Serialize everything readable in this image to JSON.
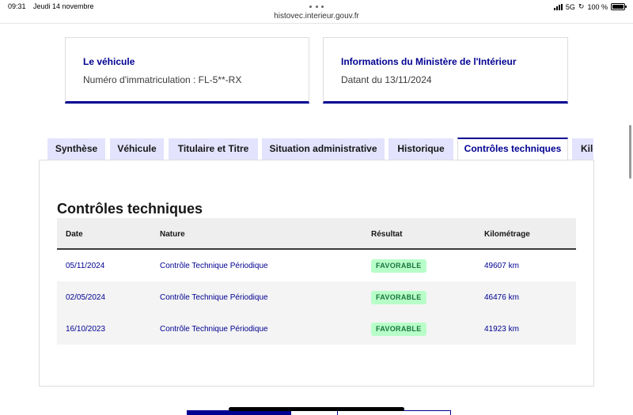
{
  "status_bar": {
    "time": "09:31",
    "date": "Jeudi 14 novembre",
    "url": "histovec.interieur.gouv.fr",
    "network": "5G",
    "battery_text": "100 %",
    "battery_level": 1.0
  },
  "vehicle_card": {
    "title": "Le véhicule",
    "text": "Numéro d'immatriculation : FL-5**-RX"
  },
  "ministry_card": {
    "title": "Informations du Ministère de l'Intérieur",
    "text": "Datant du 13/11/2024"
  },
  "tabs": [
    {
      "label": "Synthèse",
      "active": false
    },
    {
      "label": "Véhicule",
      "active": false
    },
    {
      "label": "Titulaire et Titre",
      "active": false
    },
    {
      "label": "Situation administrative",
      "active": false
    },
    {
      "label": "Historique",
      "active": false
    },
    {
      "label": "Contrôles techniques",
      "active": true
    },
    {
      "label": "Kilo",
      "active": false
    }
  ],
  "section": {
    "title": "Contrôles techniques"
  },
  "table": {
    "headers": {
      "date": "Date",
      "nature": "Nature",
      "result": "Résultat",
      "mileage": "Kilométrage"
    },
    "rows": [
      {
        "date": "05/11/2024",
        "nature": "Contrôle Technique Périodique",
        "result": "FAVORABLE",
        "mileage": "49607 km"
      },
      {
        "date": "02/05/2024",
        "nature": "Contrôle Technique Périodique",
        "result": "FAVORABLE",
        "mileage": "46476 km"
      },
      {
        "date": "16/10/2023",
        "nature": "Contrôle Technique Périodique",
        "result": "FAVORABLE",
        "mileage": "41923 km"
      }
    ]
  },
  "colors": {
    "accent": "#000091",
    "tab_background": "#e3e3fd",
    "badge_background": "#b8fec9",
    "badge_text": "#18753c"
  }
}
